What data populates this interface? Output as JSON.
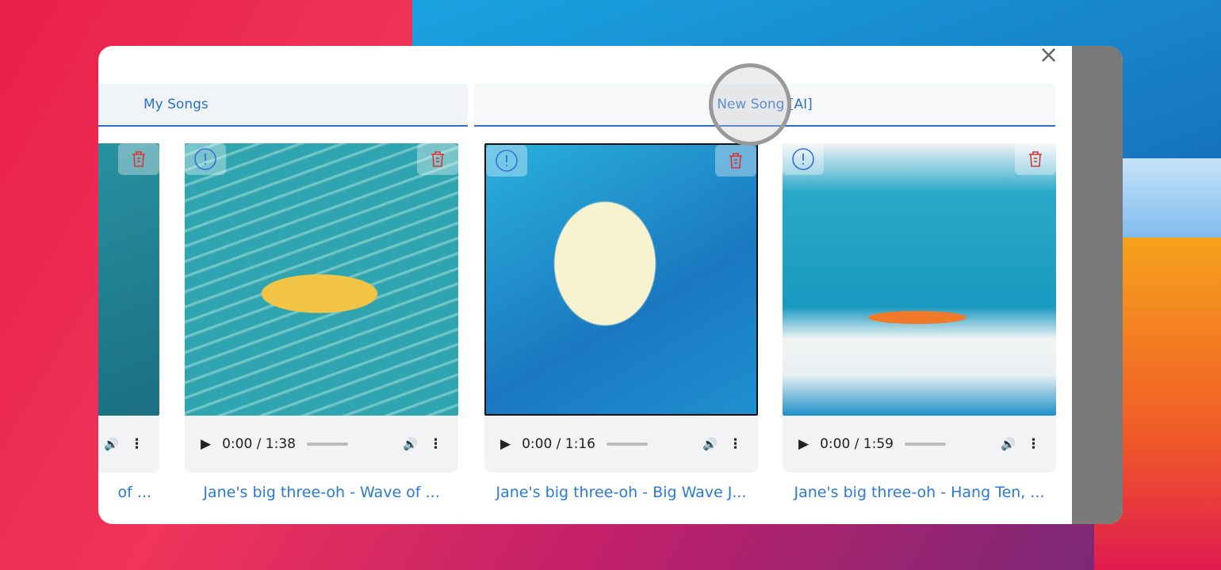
{
  "tabs": [
    {
      "label": "My Songs"
    },
    {
      "label": "New Song [AI]"
    }
  ],
  "songs": [
    {
      "time": "",
      "title": "of ..."
    },
    {
      "time": "0:00 / 1:38",
      "title": "Jane's big three-oh - Wave of ..."
    },
    {
      "time": "0:00 / 1:16",
      "title": "Jane's big three-oh - Big Wave J..."
    },
    {
      "time": "0:00 / 1:59",
      "title": "Jane's big three-oh - Hang Ten, ..."
    }
  ],
  "icons": {
    "close": "×",
    "info": "!",
    "play": "▶",
    "volume": "🔊",
    "more": "⋮"
  }
}
